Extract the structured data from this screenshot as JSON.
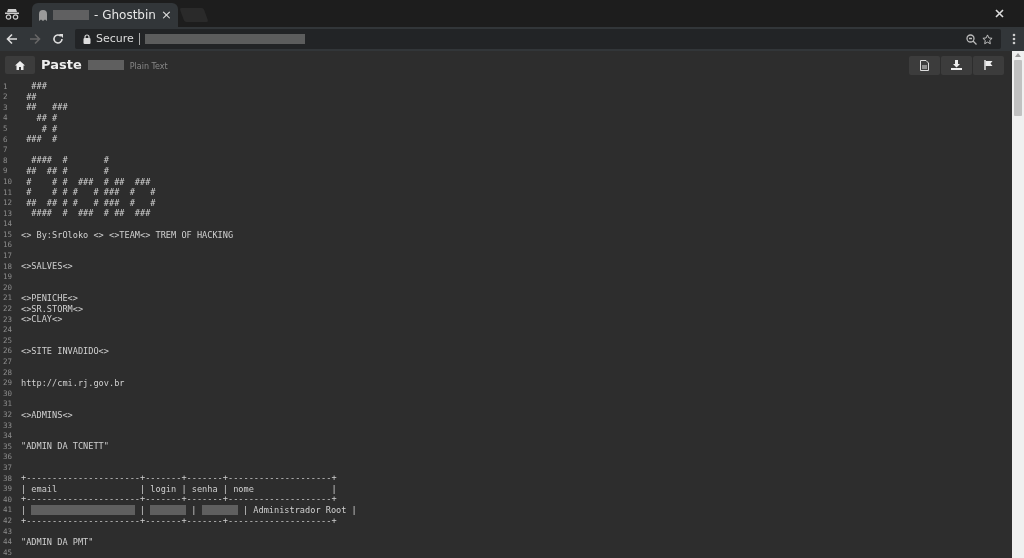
{
  "browser": {
    "tab": {
      "title": "- Ghostbin",
      "close": "×"
    },
    "address": {
      "secure_label": "Secure"
    }
  },
  "header": {
    "title": "Paste",
    "language": "Plain Text"
  },
  "lines": [
    {
      "number": "1",
      "text": "  ###"
    },
    {
      "number": "2",
      "text": " ##"
    },
    {
      "number": "3",
      "text": " ##   ###"
    },
    {
      "number": "4",
      "text": "   ## #"
    },
    {
      "number": "5",
      "text": "    # #"
    },
    {
      "number": "6",
      "text": " ###  #"
    },
    {
      "number": "7"
    },
    {
      "number": "8",
      "text": "  ####  #       #"
    },
    {
      "number": "9",
      "text": " ##  ## #       #"
    },
    {
      "number": "10",
      "text": " #    # #  ###  # ##  ###"
    },
    {
      "number": "11",
      "text": " #    # # #   # ###  #   #"
    },
    {
      "number": "12",
      "text": " ##  ## # #   # ###  #   #"
    },
    {
      "number": "13",
      "text": "  ####  #  ###  # ##  ###"
    },
    {
      "number": "14"
    },
    {
      "number": "15",
      "text": "<> By:SrOloko <> <>TEAM<> TREM OF HACKING"
    },
    {
      "number": "16"
    },
    {
      "number": "17"
    },
    {
      "number": "18",
      "text": "<>SALVES<>"
    },
    {
      "number": "19"
    },
    {
      "number": "20"
    },
    {
      "number": "21",
      "text": "<>PENICHE<>"
    },
    {
      "number": "22",
      "text": "<>SR.STORM<>"
    },
    {
      "number": "23",
      "text": "<>CLAY<>"
    },
    {
      "number": "24"
    },
    {
      "number": "25"
    },
    {
      "number": "26",
      "text": "<>SITE INVADIDO<>"
    },
    {
      "number": "27"
    },
    {
      "number": "28"
    },
    {
      "number": "29",
      "text": "http://cmi.rj.gov.br"
    },
    {
      "number": "30"
    },
    {
      "number": "31"
    },
    {
      "number": "32",
      "text": "<>ADMINS<>"
    },
    {
      "number": "33"
    },
    {
      "number": "34"
    },
    {
      "number": "35",
      "text": "\"ADMIN DA TCNETT\""
    },
    {
      "number": "36"
    },
    {
      "number": "37"
    },
    {
      "number": "38",
      "text": "+----------------------+-------+-------+--------------------+"
    },
    {
      "number": "39",
      "text": "| email                | login | senha | nome               |"
    },
    {
      "number": "40",
      "text": "+----------------------+-------+-------+--------------------+"
    },
    {
      "number": "41",
      "parts": [
        {
          "kind": "text",
          "text": "|"
        },
        {
          "kind": "redacted"
        },
        {
          "kind": "text",
          "text": "|"
        },
        {
          "kind": "redacted"
        },
        {
          "kind": "text",
          "text": "|"
        },
        {
          "kind": "redacted"
        },
        {
          "kind": "text",
          "text": "| Administrador Root |"
        }
      ]
    },
    {
      "number": "42",
      "text": "+----------------------+-------+-------+--------------------+"
    },
    {
      "number": "43"
    },
    {
      "number": "44",
      "text": "\"ADMIN DA PMT\""
    },
    {
      "number": "45"
    }
  ]
}
